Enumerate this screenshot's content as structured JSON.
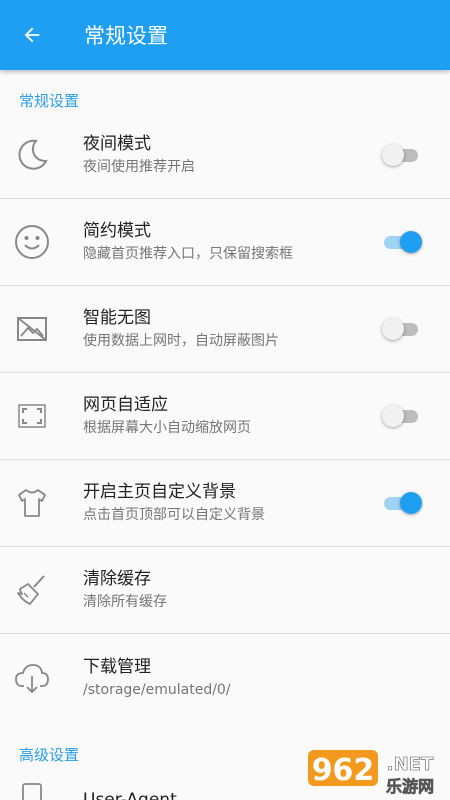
{
  "appbar": {
    "title": "常规设置",
    "back_icon": "arrow-left-icon"
  },
  "sections": {
    "general": "常规设置",
    "advanced": "高级设置"
  },
  "rows": [
    {
      "title": "夜间模式",
      "subtitle": "夜间使用推荐开启",
      "icon": "moon-icon",
      "toggle": false
    },
    {
      "title": "简约模式",
      "subtitle": "隐藏首页推荐入口，只保留搜索框",
      "icon": "smiley-icon",
      "toggle": true
    },
    {
      "title": "智能无图",
      "subtitle": "使用数据上网时，自动屏蔽图片",
      "icon": "no-image-icon",
      "toggle": false
    },
    {
      "title": "网页自适应",
      "subtitle": "根据屏幕大小自动缩放网页",
      "icon": "fit-screen-icon",
      "toggle": false
    },
    {
      "title": "开启主页自定义背景",
      "subtitle": "点击首页顶部可以自定义背景",
      "icon": "tshirt-icon",
      "toggle": true
    },
    {
      "title": "清除缓存",
      "subtitle": "清除所有缓存",
      "icon": "broom-icon"
    },
    {
      "title": "下载管理",
      "subtitle": "/storage/emulated/0/",
      "icon": "cloud-download-icon"
    }
  ],
  "advanced_rows": [
    {
      "title": "User-Agent",
      "icon": "phone-icon"
    }
  ],
  "watermark": {
    "number": "962",
    "domain": ".NET",
    "brand": "乐游网"
  },
  "colors": {
    "primary": "#1e9ff2",
    "section": "#2a9fe6",
    "track_on": "#9fd3f6",
    "track_off": "#bdbdbd"
  }
}
